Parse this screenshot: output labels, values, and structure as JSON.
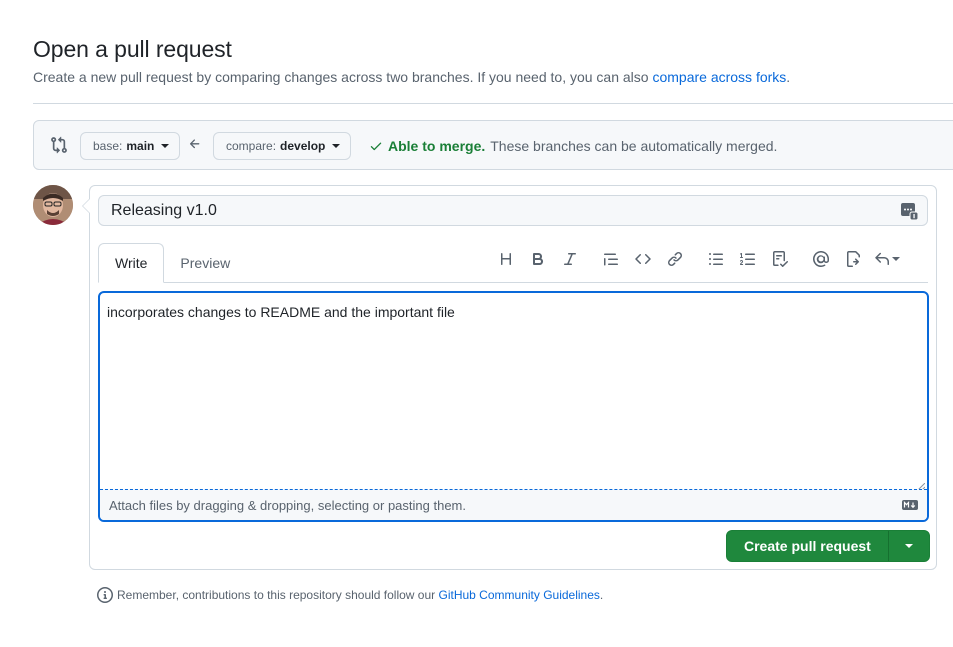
{
  "header": {
    "title": "Open a pull request",
    "subtitle": "Create a new pull request by comparing changes across two branches. If you need to, you can also ",
    "subtitle_link": "compare across forks",
    "subtitle_end": "."
  },
  "compare": {
    "base_prefix": "base:",
    "base_branch": "main",
    "compare_prefix": "compare:",
    "compare_branch": "develop",
    "merge_status_strong": "Able to merge.",
    "merge_status_text": "These branches can be automatically merged."
  },
  "form": {
    "title_value": "Releasing v1.0",
    "tabs": [
      {
        "label": "Write",
        "active": true
      },
      {
        "label": "Preview",
        "active": false
      }
    ],
    "toolbar": [
      "heading-icon",
      "bold-icon",
      "italic-icon",
      "quote-icon",
      "code-icon",
      "link-icon",
      "unordered-list-icon",
      "ordered-list-icon",
      "task-list-icon",
      "mention-icon",
      "cross-reference-icon",
      "saved-replies-icon"
    ],
    "body_value": "incorporates changes to README and the important file",
    "attach_text": "Attach files by dragging & dropping, selecting or pasting them.",
    "submit_label": "Create pull request"
  },
  "footer": {
    "note": "Remember, contributions to this repository should follow our ",
    "link": "GitHub Community Guidelines",
    "end": "."
  },
  "colors": {
    "accent": "#0969da",
    "success": "#1a7f37",
    "primary_button": "#1f883d",
    "muted": "#59636e"
  }
}
